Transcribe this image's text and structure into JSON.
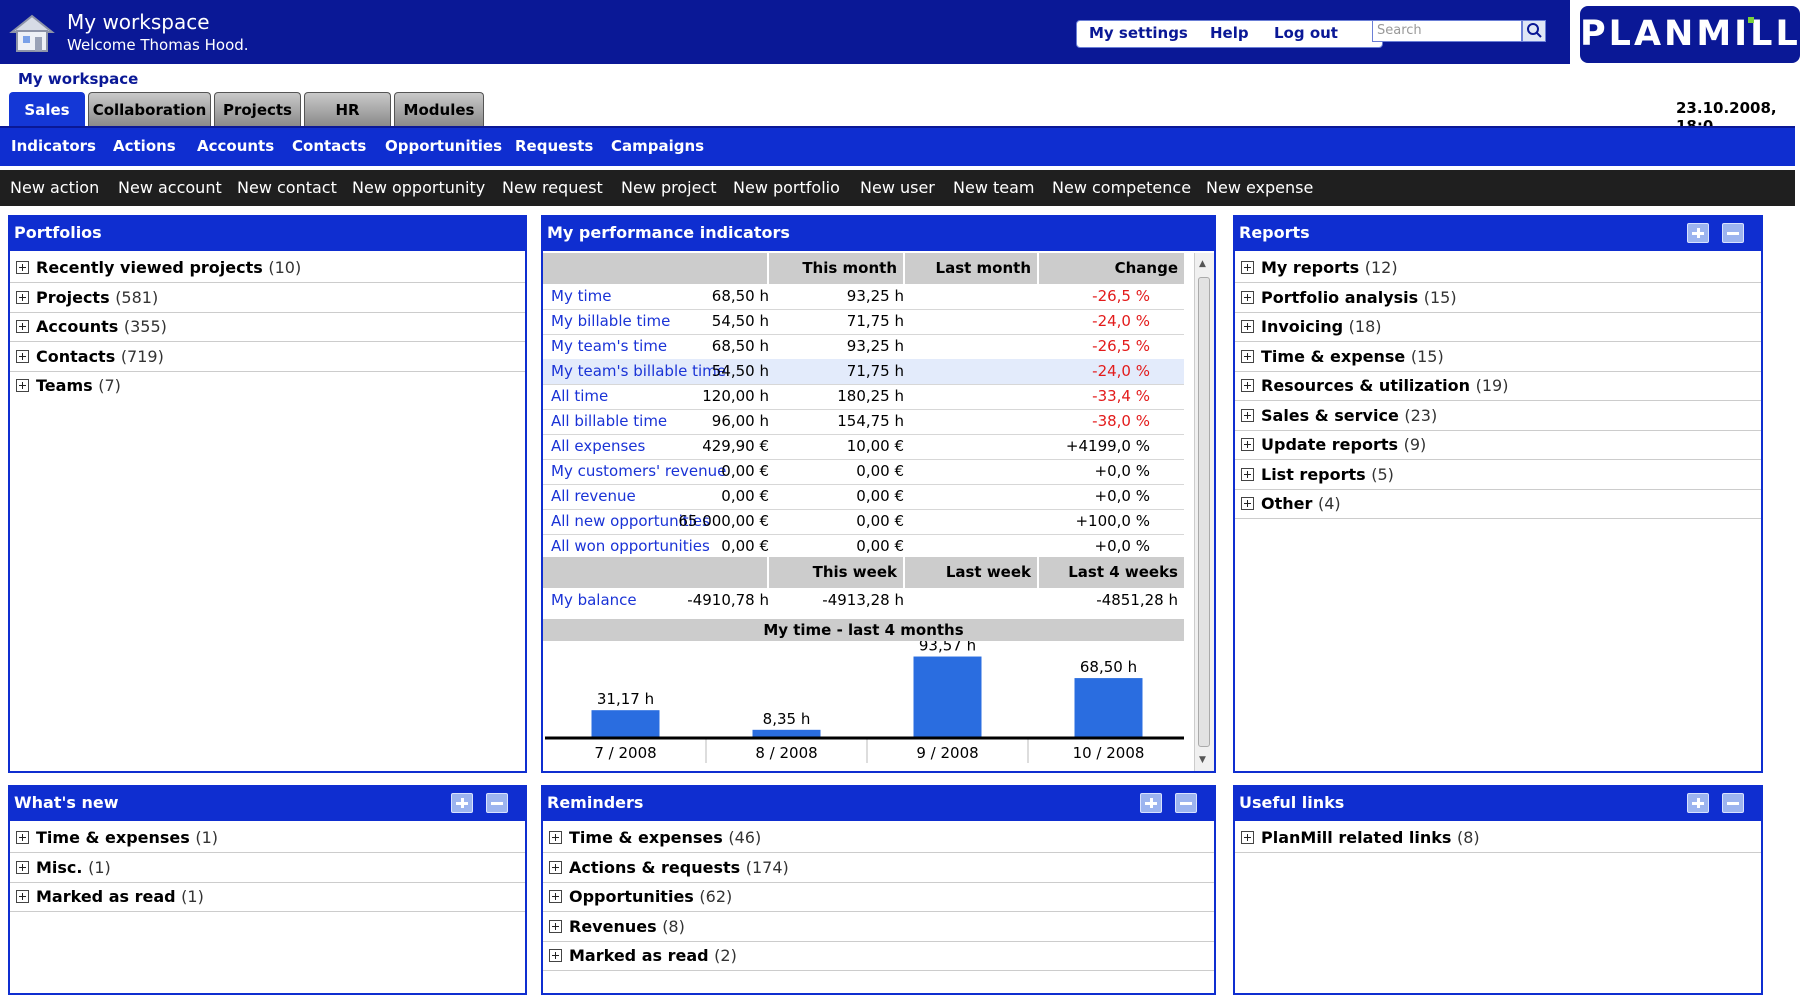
{
  "header": {
    "title": "My workspace",
    "welcome": "Welcome Thomas Hood.",
    "links": [
      "My settings",
      "Help",
      "Log out"
    ],
    "search_placeholder": "Search",
    "brand": "PLANMILL"
  },
  "breadcrumb": "My workspace",
  "tabs": [
    "Sales",
    "Collaboration",
    "Projects",
    "HR",
    "Modules"
  ],
  "active_tab": "Sales",
  "datetime": "23.10.2008, 18:0",
  "subnav": [
    "Indicators",
    "Actions",
    "Accounts",
    "Contacts",
    "Opportunities",
    "Requests",
    "Campaigns"
  ],
  "actions": [
    "New action",
    "New account",
    "New contact",
    "New opportunity",
    "New request",
    "New project",
    "New portfolio",
    "New user",
    "New team",
    "New competence",
    "New expense"
  ],
  "portfolios": {
    "title": "Portfolios",
    "items": [
      {
        "label": "Recently viewed projects",
        "count": "(10)"
      },
      {
        "label": "Projects",
        "count": "(581)"
      },
      {
        "label": "Accounts",
        "count": "(355)"
      },
      {
        "label": "Contacts",
        "count": "(719)"
      },
      {
        "label": "Teams",
        "count": "(7)"
      }
    ]
  },
  "indicators": {
    "title": "My performance indicators",
    "headers": [
      "This month",
      "Last month",
      "Change"
    ],
    "rows": [
      {
        "name": "My time",
        "this": "68,50 h",
        "last": "93,25 h",
        "change": "-26,5 %"
      },
      {
        "name": "My billable time",
        "this": "54,50 h",
        "last": "71,75 h",
        "change": "-24,0 %"
      },
      {
        "name": "My team's time",
        "this": "68,50 h",
        "last": "93,25 h",
        "change": "-26,5 %"
      },
      {
        "name": "My team's billable time",
        "this": "54,50 h",
        "last": "71,75 h",
        "change": "-24,0 %"
      },
      {
        "name": "All time",
        "this": "120,00 h",
        "last": "180,25 h",
        "change": "-33,4 %"
      },
      {
        "name": "All billable time",
        "this": "96,00 h",
        "last": "154,75 h",
        "change": "-38,0 %"
      },
      {
        "name": "All expenses",
        "this": "429,90 €",
        "last": "10,00 €",
        "change": "+4199,0 %"
      },
      {
        "name": "My customers' revenue",
        "this": "0,00 €",
        "last": "0,00 €",
        "change": "+0,0 %"
      },
      {
        "name": "All revenue",
        "this": "0,00 €",
        "last": "0,00 €",
        "change": "+0,0 %"
      },
      {
        "name": "All new opportunities",
        "this": "65 000,00 €",
        "last": "0,00 €",
        "change": "+100,0 %"
      },
      {
        "name": "All won opportunities",
        "this": "0,00 €",
        "last": "0,00 €",
        "change": "+0,0 %"
      }
    ],
    "week_headers": [
      "This week",
      "Last week",
      "Last 4 weeks"
    ],
    "balance": {
      "name": "My balance",
      "this": "-4910,78 h",
      "last": "-4913,28 h",
      "four": "-4851,28 h"
    },
    "negative_color": "#e31b1b"
  },
  "chart_data": {
    "type": "bar",
    "title": "My time - last 4 months",
    "categories": [
      "7 / 2008",
      "8 / 2008",
      "9 / 2008",
      "10 / 2008"
    ],
    "values": [
      31.17,
      8.35,
      93.57,
      68.5
    ],
    "labels": [
      "31,17 h",
      "8,35 h",
      "93,57 h",
      "68,50 h"
    ],
    "color": "#2a6de0"
  },
  "reports": {
    "title": "Reports",
    "items": [
      {
        "label": "My reports",
        "count": "(12)"
      },
      {
        "label": "Portfolio analysis",
        "count": "(15)"
      },
      {
        "label": "Invoicing",
        "count": "(18)"
      },
      {
        "label": "Time & expense",
        "count": "(15)"
      },
      {
        "label": "Resources & utilization",
        "count": "(19)"
      },
      {
        "label": "Sales & service",
        "count": "(23)"
      },
      {
        "label": "Update reports",
        "count": "(9)"
      },
      {
        "label": "List reports",
        "count": "(5)"
      },
      {
        "label": "Other",
        "count": "(4)"
      }
    ]
  },
  "whatsnew": {
    "title": "What's new",
    "items": [
      {
        "label": "Time & expenses",
        "count": "(1)"
      },
      {
        "label": "Misc.",
        "count": "(1)"
      },
      {
        "label": "Marked as read",
        "count": "(1)"
      }
    ]
  },
  "reminders": {
    "title": "Reminders",
    "items": [
      {
        "label": "Time & expenses",
        "count": "(46)"
      },
      {
        "label": "Actions & requests",
        "count": "(174)"
      },
      {
        "label": "Opportunities",
        "count": "(62)"
      },
      {
        "label": "Revenues",
        "count": "(8)"
      },
      {
        "label": "Marked as read",
        "count": "(2)"
      }
    ]
  },
  "links": {
    "title": "Useful links",
    "items": [
      {
        "label": "PlanMill related links",
        "count": "(8)"
      }
    ]
  },
  "colors": {
    "header": "#0a1896",
    "nav": "#0f2ed0",
    "active_tab": "#1437d6",
    "link": "#1a33d6"
  }
}
